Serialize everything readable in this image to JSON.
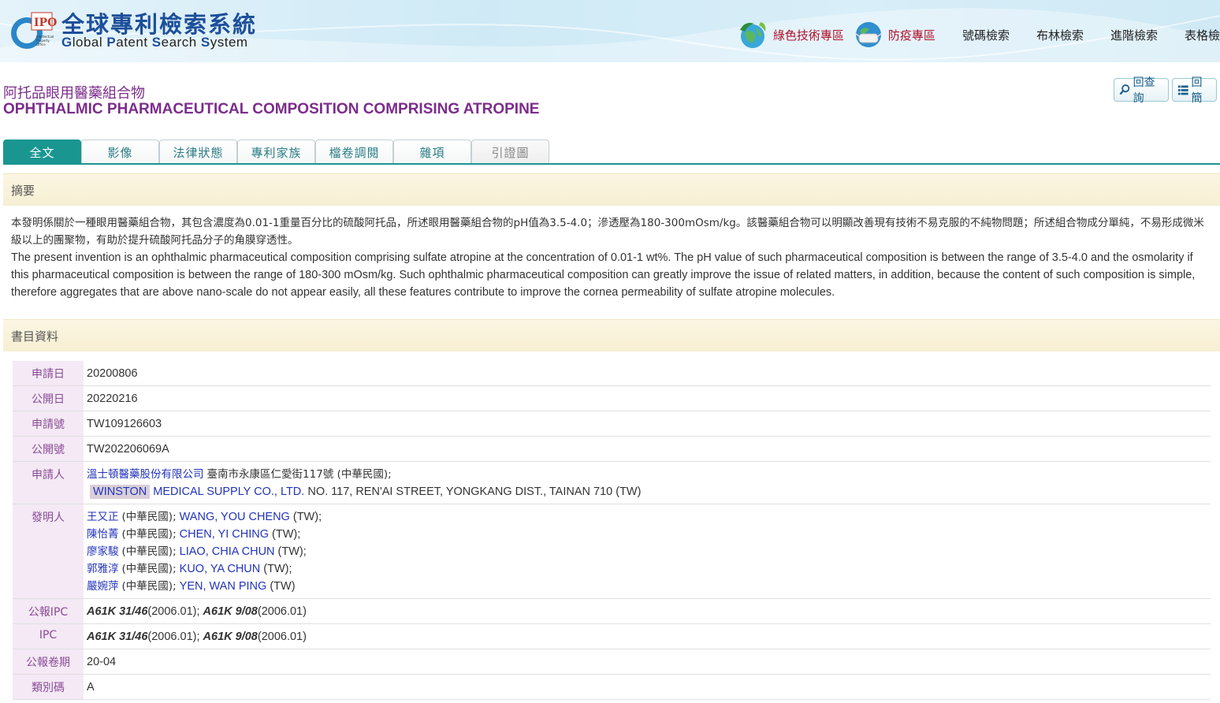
{
  "site": {
    "title_zh": "全球專利檢索系統",
    "title_en_words": [
      [
        "G",
        "lobal"
      ],
      [
        "P",
        "atent"
      ],
      [
        "S",
        "earch"
      ],
      [
        "S",
        "ystem"
      ]
    ],
    "logo_text": "IPO",
    "logo_sub": [
      "Intellectual",
      "Property",
      "Office"
    ]
  },
  "topnav": {
    "green": "綠色技術專區",
    "epidemic": "防疫專區",
    "number": "號碼檢索",
    "boolean": "布林檢索",
    "advanced": "進階檢索",
    "table": "表格檢"
  },
  "patent": {
    "title_zh": "阿托品眼用醫藥組合物",
    "title_en": "OPHTHALMIC PHARMACEUTICAL COMPOSITION COMPRISING ATROPINE"
  },
  "buttons": {
    "back_query": "回查詢",
    "back_list": "回簡"
  },
  "tabs": [
    "全文",
    "影像",
    "法律狀態",
    "專利家族",
    "檔卷調閱",
    "雜項",
    "引證圖"
  ],
  "sections": {
    "abstract": "摘要",
    "biblio": "書目資料"
  },
  "abstract": {
    "zh": "本發明係關於一種眼用醫藥組合物，其包含濃度為0.01-1重量百分比的硫酸阿托品，所述眼用醫藥組合物的pH值為3.5-4.0；滲透壓為180-300mOsm/kg。該醫藥組合物可以明顯改善現有技術不易克服的不純物問題；所述組合物成分單純，不易形成微米級以上的團聚物，有助於提升硫酸阿托品分子的角膜穿透性。",
    "en": "The present invention is an ophthalmic pharmaceutical composition comprising sulfate atropine at the concentration of 0.01-1 wt%. The pH value of such pharmaceutical composition is between the range of 3.5-4.0 and the osmolarity if this pharmaceutical composition is between the range of 180-300 mOsm/kg. Such ophthalmic pharmaceutical composition can greatly improve the issue of related matters, in addition, because the content of such composition is simple, therefore aggregates that are above nano-scale do not appear easily, all these features contribute to improve the cornea permeability of sulfate atropine molecules."
  },
  "biblio": {
    "app_date_label": "申請日",
    "app_date": "20200806",
    "pub_date_label": "公開日",
    "pub_date": "20220216",
    "app_no_label": "申請號",
    "app_no": "TW109126603",
    "pub_no_label": "公開號",
    "pub_no": "TW202206069A",
    "applicant_label": "申請人",
    "applicant_zh_name": "溫士頓醫藥股份有限公司",
    "applicant_zh_addr": "臺南市永康區仁愛街117號 (中華民國);",
    "applicant_en_hl": "WINSTON",
    "applicant_en_name": "MEDICAL SUPPLY CO., LTD.",
    "applicant_en_addr": "NO. 117, REN'AI STREET, YONGKANG DIST., TAINAN 710 (TW)",
    "inventor_label": "發明人",
    "inventors": [
      {
        "zh": "王又正",
        "zh_country": "(中華民國);",
        "en": "WANG, YOU CHENG",
        "en_country": "(TW);"
      },
      {
        "zh": "陳怡菁",
        "zh_country": "(中華民國);",
        "en": "CHEN, YI CHING",
        "en_country": "(TW);"
      },
      {
        "zh": "廖家駿",
        "zh_country": "(中華民國);",
        "en": "LIAO, CHIA CHUN",
        "en_country": "(TW);"
      },
      {
        "zh": "郭雅淳",
        "zh_country": "(中華民國);",
        "en": "KUO, YA CHUN",
        "en_country": "(TW);"
      },
      {
        "zh": "嚴婉萍",
        "zh_country": "(中華民國);",
        "en": "YEN, WAN PING",
        "en_country": "(TW)"
      }
    ],
    "gazette_ipc_label": "公報IPC",
    "ipc_label": "IPC",
    "ipc1": "A61K 31/46",
    "ipc1_ver": "(2006.01);",
    "ipc2": "A61K 9/08",
    "ipc2_ver": "(2006.01)",
    "volume_label": "公報卷期",
    "volume": "20-04",
    "kind_label": "類別碼",
    "kind": "A"
  },
  "colors": {
    "accent": "#1a9691",
    "title": "#7b2d8b",
    "label_bg": "#f4e9f5",
    "link": "#2233bb"
  }
}
